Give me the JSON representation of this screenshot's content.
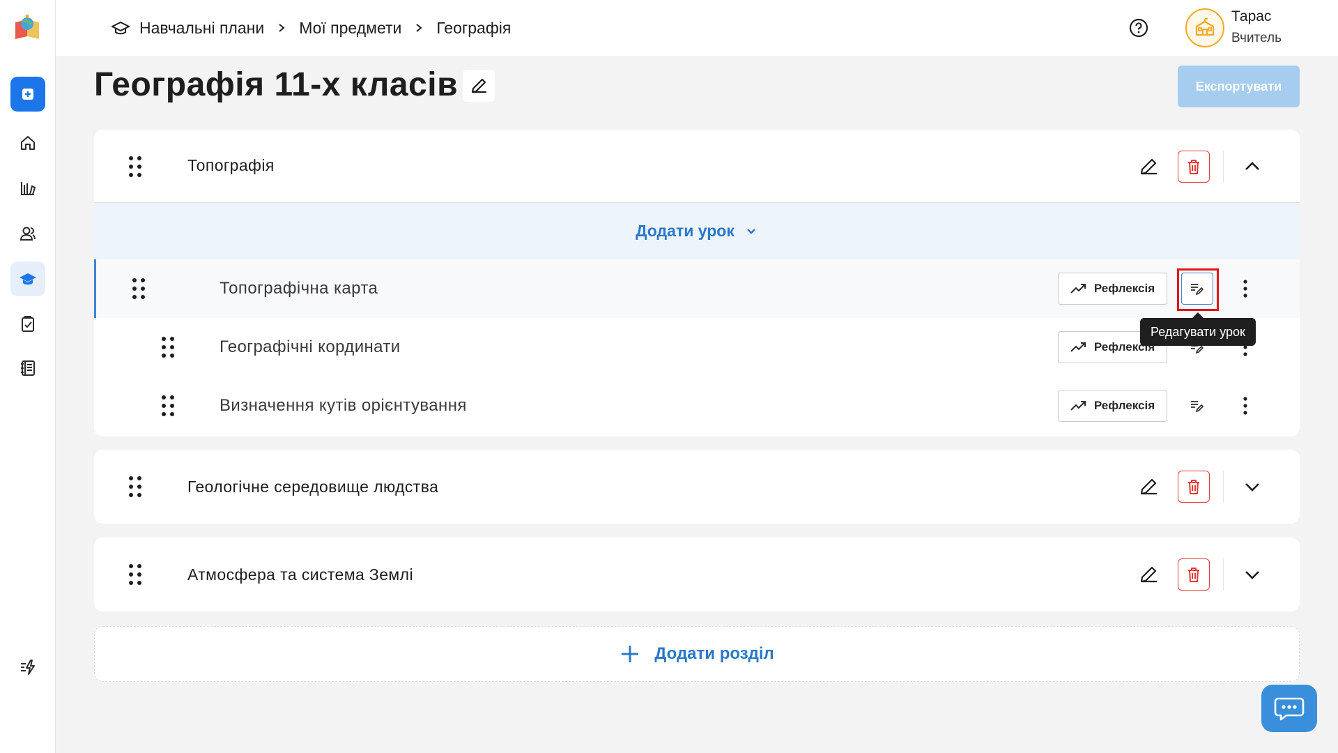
{
  "sidebar": {
    "items": [
      {
        "icon": "add-square-icon"
      },
      {
        "icon": "home-icon"
      },
      {
        "icon": "library-icon"
      },
      {
        "icon": "users-icon"
      },
      {
        "icon": "graduation-cap-icon"
      },
      {
        "icon": "assignment-icon"
      },
      {
        "icon": "journal-icon"
      },
      {
        "icon": "flash-list-icon"
      }
    ]
  },
  "header": {
    "breadcrumb": [
      "Навчальні плани",
      "Мої предмети",
      "Географія"
    ],
    "user": {
      "name": "Тарас",
      "role": "Вчитель"
    }
  },
  "page": {
    "title": "Географія 11-х класів",
    "export_label": "Експортувати"
  },
  "sections": [
    {
      "title": "Топографія",
      "expanded": true,
      "add_lesson_label": "Додати урок",
      "lessons": [
        {
          "title": "Топографічна карта",
          "reflection_label": "Рефлексія"
        },
        {
          "title": "Географічні кординати",
          "reflection_label": "Рефлексія"
        },
        {
          "title": "Визначення кутів орієнтування",
          "reflection_label": "Рефлексія"
        }
      ]
    },
    {
      "title": "Геологічне середовище людства",
      "expanded": false
    },
    {
      "title": "Атмосфера та система Землі",
      "expanded": false
    }
  ],
  "tooltip": {
    "text": "Редагувати урок"
  },
  "add_section_label": "Додати розділ",
  "colors": {
    "accent": "#1c76ea",
    "link": "#2a78c9",
    "delete": "#e53935",
    "export_disabled": "#a6cdef"
  }
}
